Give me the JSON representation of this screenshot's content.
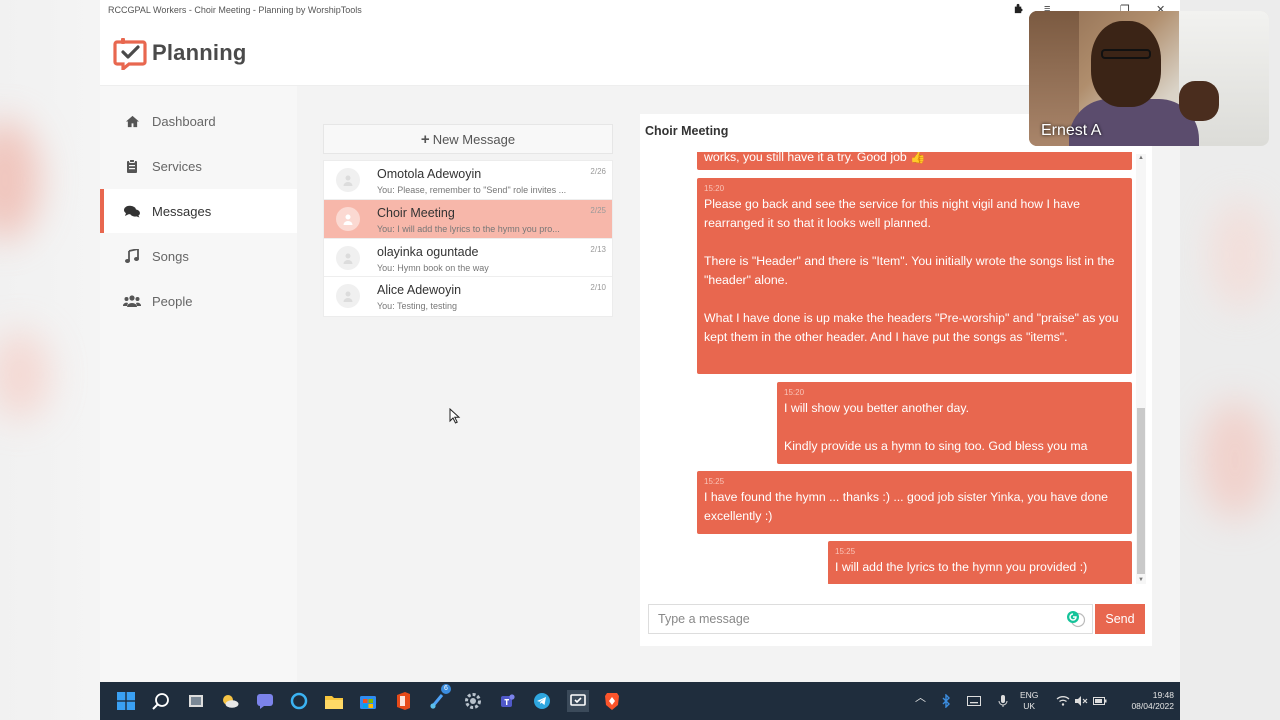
{
  "window": {
    "title": "RCCGPAL Workers - Choir Meeting - Planning by WorshipTools"
  },
  "app": {
    "name": "Planning"
  },
  "sidebar": {
    "items": [
      {
        "label": "Dashboard",
        "icon": "home-icon",
        "active": false
      },
      {
        "label": "Services",
        "icon": "clipboard-icon",
        "active": false
      },
      {
        "label": "Messages",
        "icon": "chat-bubbles-icon",
        "active": true
      },
      {
        "label": "Songs",
        "icon": "music-note-icon",
        "active": false
      },
      {
        "label": "People",
        "icon": "users-icon",
        "active": false
      }
    ]
  },
  "messages": {
    "new_message_label": "New Message",
    "conversations": [
      {
        "name": "Omotola Adewoyin",
        "preview": "You: Please, remember to \"Send\" role invites ...",
        "date": "2/26",
        "active": false
      },
      {
        "name": "Choir Meeting",
        "preview": "You: I will add the lyrics to the hymn you pro...",
        "date": "2/25",
        "active": true
      },
      {
        "name": "olayinka oguntade",
        "preview": "You: Hymn book on the way",
        "date": "2/13",
        "active": false
      },
      {
        "name": "Alice Adewoyin",
        "preview": "You: Testing, testing",
        "date": "2/10",
        "active": false
      }
    ]
  },
  "chat": {
    "title": "Choir Meeting",
    "bubbles": [
      {
        "time": "",
        "text": "works, you still have it a try. Good job 👍"
      },
      {
        "time": "15:20",
        "text": "Please go back and see the service for this night vigil and how I have rearranged it so that it looks well planned.\n\nThere is \"Header\" and there is \"Item\". You initially wrote the songs list in the \"header\" alone.\n\nWhat I have done is up make the headers \"Pre-worship\" and \"praise\" as you kept them in the other header. And I have put the songs as \"items\"."
      },
      {
        "time": "15:20",
        "text": "I will show you better another day.\n\nKindly provide us a hymn to sing too. God bless you ma"
      },
      {
        "time": "15:25",
        "text": "I have found the hymn ... thanks :) ... good job sister Yinka, you have done excellently :)"
      },
      {
        "time": "15:25",
        "text": "I will add the lyrics to the hymn you provided :)"
      }
    ],
    "input_placeholder": "Type a message",
    "send_label": "Send"
  },
  "video": {
    "participant_name": "Ernest A"
  },
  "taskbar": {
    "pinned_icons": [
      "windows-start-icon",
      "search-icon",
      "task-view-icon",
      "weather-icon",
      "teams-chat-icon",
      "cortana-icon",
      "file-explorer-icon",
      "store-icon",
      "office-icon",
      "snipping-tool-icon",
      "settings-icon",
      "teams-icon",
      "telegram-icon",
      "planning-app-icon",
      "brave-browser-icon"
    ],
    "snipping_badge": "6",
    "language_line1": "ENG",
    "language_line2": "UK",
    "time": "19:48",
    "date": "08/04/2022"
  },
  "colors": {
    "accent": "#e8674f",
    "accent_light": "#f7b7aa",
    "sidebar_bg": "#f7f7f7",
    "taskbar_bg": "#1f2d3d"
  }
}
